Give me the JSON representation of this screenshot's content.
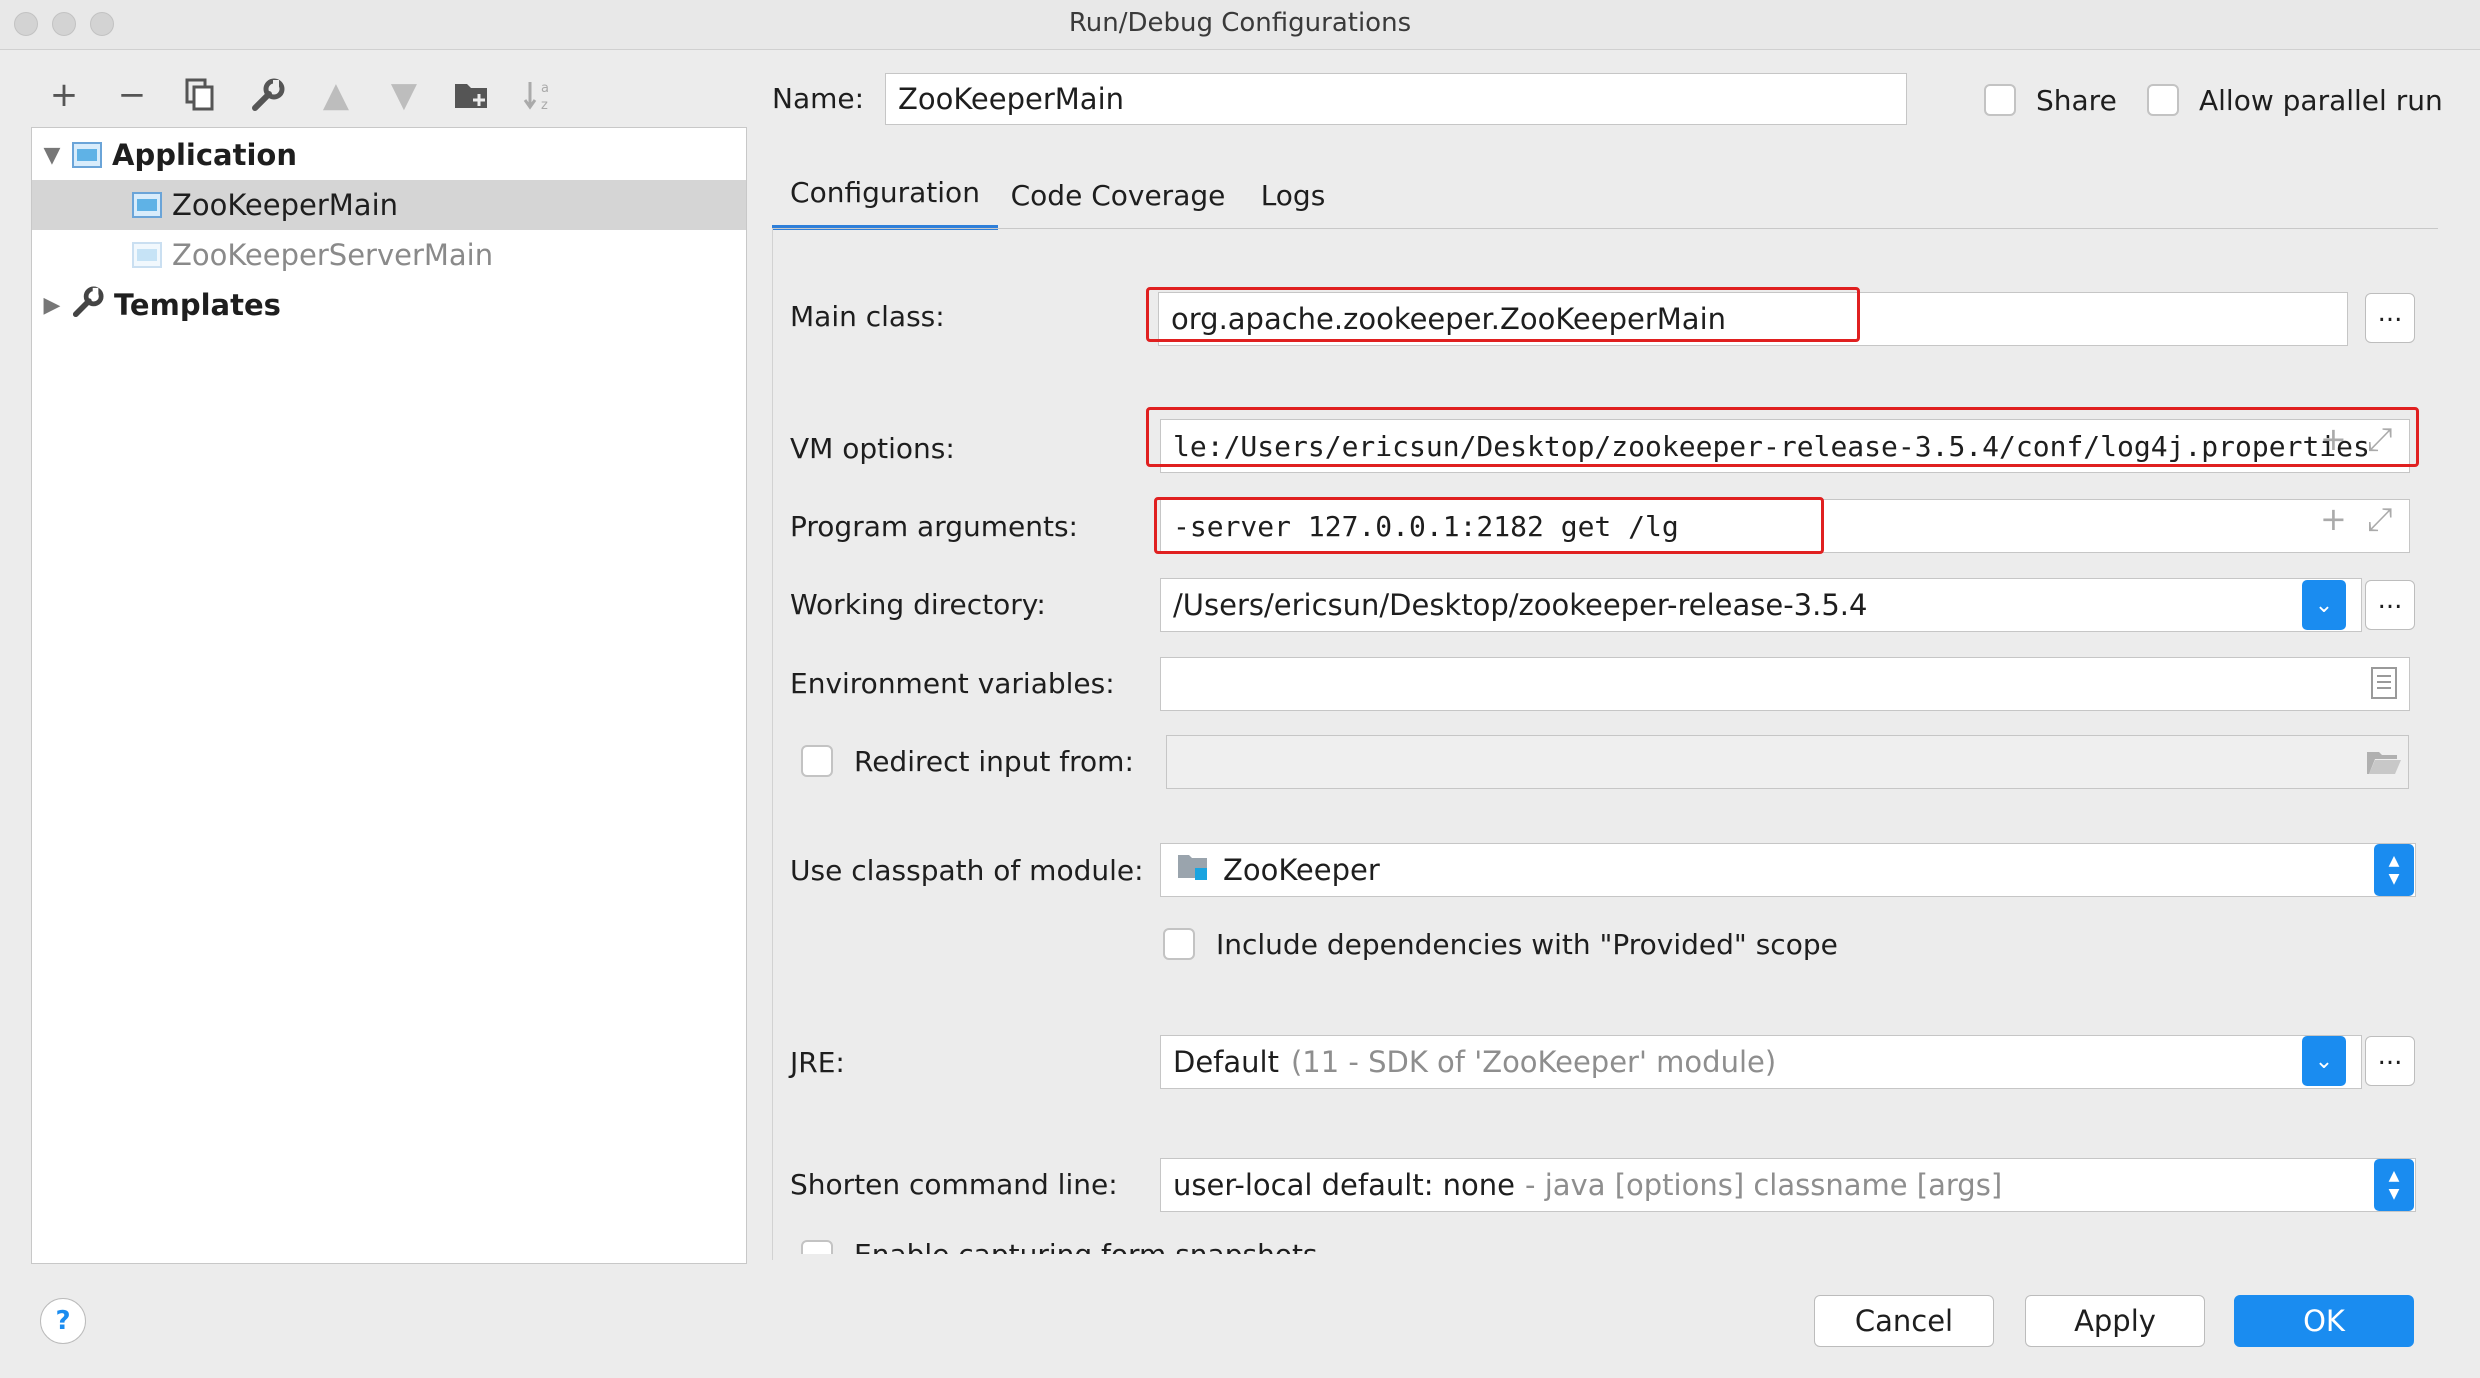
{
  "window": {
    "title": "Run/Debug Configurations"
  },
  "toolbar": {
    "icons": [
      "plus-icon",
      "minus-icon",
      "copy-icon",
      "wrench-icon",
      "arrow-up-icon",
      "arrow-down-icon",
      "folder-add-icon",
      "sort-icon"
    ]
  },
  "tree": {
    "application_label": "Application",
    "items": [
      {
        "label": "ZooKeeperMain",
        "selected": true
      },
      {
        "label": "ZooKeeperServerMain",
        "selected": false
      }
    ],
    "templates_label": "Templates"
  },
  "header": {
    "name_label": "Name:",
    "name_value": "ZooKeeperMain",
    "share_label": "Share",
    "parallel_label": "Allow parallel run"
  },
  "tabs": [
    {
      "label": "Configuration",
      "active": true
    },
    {
      "label": "Code Coverage",
      "active": false
    },
    {
      "label": "Logs",
      "active": false
    }
  ],
  "form": {
    "main_class_label": "Main class:",
    "main_class_value": "org.apache.zookeeper.ZooKeeperMain",
    "vm_options_label": "VM options:",
    "vm_options_value": "le:/Users/ericsun/Desktop/zookeeper-release-3.5.4/conf/log4j.properties",
    "program_args_label": "Program arguments:",
    "program_args_value": "-server 127.0.0.1:2182 get /lg",
    "working_dir_label": "Working directory:",
    "working_dir_value": "/Users/ericsun/Desktop/zookeeper-release-3.5.4",
    "env_vars_label": "Environment variables:",
    "env_vars_value": "",
    "redirect_label": "Redirect input from:",
    "classpath_label": "Use classpath of module:",
    "classpath_value": "ZooKeeper",
    "include_deps_label": "Include dependencies with \"Provided\" scope",
    "jre_label": "JRE:",
    "jre_value": "Default",
    "jre_hint": "(11 - SDK of 'ZooKeeper' module)",
    "shorten_label": "Shorten command line:",
    "shorten_value": "user-local default: none",
    "shorten_hint": "- java [options] classname [args]",
    "partial_label": "Enable capturing form snapshots",
    "browse_label": "..."
  },
  "footer": {
    "help_label": "?",
    "cancel_label": "Cancel",
    "apply_label": "Apply",
    "ok_label": "OK"
  },
  "colors": {
    "accent": "#1a8cf0",
    "highlight_box": "#e02020",
    "selection": "#d5d5d5"
  }
}
